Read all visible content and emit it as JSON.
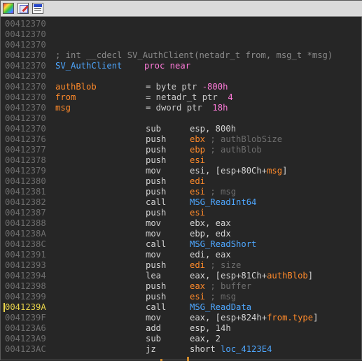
{
  "toolbar": {
    "icons": [
      "graph-view-icon",
      "edit-function-icon",
      "hex-view-icon"
    ]
  },
  "header": {
    "addresses": [
      "00412370",
      "00412370",
      "00412370"
    ],
    "proto_addr": "00412370",
    "proto_text": "; int __cdecl SV_AuthClient(netadr_t from, msg_t *msg)",
    "proc_addr": "00412370",
    "proc_label": "SV_AuthClient",
    "proc_kw": "proc near",
    "blank_addr": "00412370"
  },
  "vars": [
    {
      "addr": "00412370",
      "name": "authBlob",
      "def": "= byte ptr ",
      "num": "-800h"
    },
    {
      "addr": "00412370",
      "name": "from",
      "def": "= netadr_t ptr  ",
      "num": "4"
    },
    {
      "addr": "00412370",
      "name": "msg",
      "def": "= dword ptr  ",
      "num": "18h"
    }
  ],
  "after_vars_addr": "00412370",
  "code": [
    {
      "addr": "00412370",
      "mnem": "sub",
      "parts": [
        {
          "t": "imm",
          "v": "esp, 800h"
        }
      ]
    },
    {
      "addr": "00412376",
      "mnem": "push",
      "parts": [
        {
          "t": "reg",
          "v": "ebx"
        },
        {
          "t": "cmt",
          "v": " ; authBlobSize"
        }
      ]
    },
    {
      "addr": "00412377",
      "mnem": "push",
      "parts": [
        {
          "t": "reg",
          "v": "ebp"
        },
        {
          "t": "cmt",
          "v": " ; authBlob"
        }
      ]
    },
    {
      "addr": "00412378",
      "mnem": "push",
      "parts": [
        {
          "t": "reg",
          "v": "esi"
        }
      ]
    },
    {
      "addr": "00412379",
      "mnem": "mov",
      "parts": [
        {
          "t": "imm",
          "v": "esi, [esp+80Ch+"
        },
        {
          "t": "svar",
          "v": "msg"
        },
        {
          "t": "imm",
          "v": "]"
        }
      ]
    },
    {
      "addr": "00412380",
      "mnem": "push",
      "parts": [
        {
          "t": "reg",
          "v": "edi"
        }
      ]
    },
    {
      "addr": "00412381",
      "mnem": "push",
      "parts": [
        {
          "t": "reg",
          "v": "esi"
        },
        {
          "t": "cmt",
          "v": " ; msg"
        }
      ]
    },
    {
      "addr": "00412382",
      "mnem": "call",
      "parts": [
        {
          "t": "fn",
          "v": "MSG_ReadInt64"
        }
      ]
    },
    {
      "addr": "00412387",
      "mnem": "push",
      "parts": [
        {
          "t": "reg",
          "v": "esi"
        }
      ]
    },
    {
      "addr": "00412388",
      "mnem": "mov",
      "parts": [
        {
          "t": "imm",
          "v": "ebx, eax"
        }
      ]
    },
    {
      "addr": "0041238A",
      "mnem": "mov",
      "parts": [
        {
          "t": "imm",
          "v": "ebp, edx"
        }
      ]
    },
    {
      "addr": "0041238C",
      "mnem": "call",
      "parts": [
        {
          "t": "fn",
          "v": "MSG_ReadShort"
        }
      ]
    },
    {
      "addr": "00412391",
      "mnem": "mov",
      "parts": [
        {
          "t": "imm",
          "v": "edi, eax"
        }
      ]
    },
    {
      "addr": "00412393",
      "mnem": "push",
      "parts": [
        {
          "t": "reg",
          "v": "edi"
        },
        {
          "t": "cmt",
          "v": " ; size"
        }
      ]
    },
    {
      "addr": "00412394",
      "mnem": "lea",
      "parts": [
        {
          "t": "imm",
          "v": "eax, [esp+81Ch+"
        },
        {
          "t": "svar",
          "v": "authBlob"
        },
        {
          "t": "imm",
          "v": "]"
        }
      ]
    },
    {
      "addr": "00412398",
      "mnem": "push",
      "parts": [
        {
          "t": "reg",
          "v": "eax"
        },
        {
          "t": "cmt",
          "v": " ; buffer"
        }
      ]
    },
    {
      "addr": "00412399",
      "mnem": "push",
      "parts": [
        {
          "t": "reg",
          "v": "esi"
        },
        {
          "t": "cmt",
          "v": " ; msg"
        }
      ]
    },
    {
      "addr": "0041239A",
      "mnem": "call",
      "parts": [
        {
          "t": "fn",
          "v": "MSG_ReadData"
        }
      ],
      "current": true
    },
    {
      "addr": "0041239F",
      "mnem": "mov",
      "parts": [
        {
          "t": "imm",
          "v": "eax, [esp+824h+"
        },
        {
          "t": "svar",
          "v": "from.type"
        },
        {
          "t": "imm",
          "v": "]"
        }
      ]
    },
    {
      "addr": "004123A6",
      "mnem": "add",
      "parts": [
        {
          "t": "imm",
          "v": "esp, 14h"
        }
      ]
    },
    {
      "addr": "004123A9",
      "mnem": "sub",
      "parts": [
        {
          "t": "imm",
          "v": "eax, 2"
        }
      ]
    },
    {
      "addr": "004123AC",
      "mnem": "jz",
      "parts": [
        {
          "t": "imm",
          "v": "short "
        },
        {
          "t": "lbl",
          "v": "loc_4123E4"
        }
      ]
    }
  ],
  "colors": {
    "background": "#262626",
    "address": "#6e6e6e",
    "label": "#4ea7ff",
    "register": "#ff8a2a",
    "keyword": "#ff7ad9",
    "comment": "#6e6e6e",
    "current_line": "#e8d44a"
  }
}
